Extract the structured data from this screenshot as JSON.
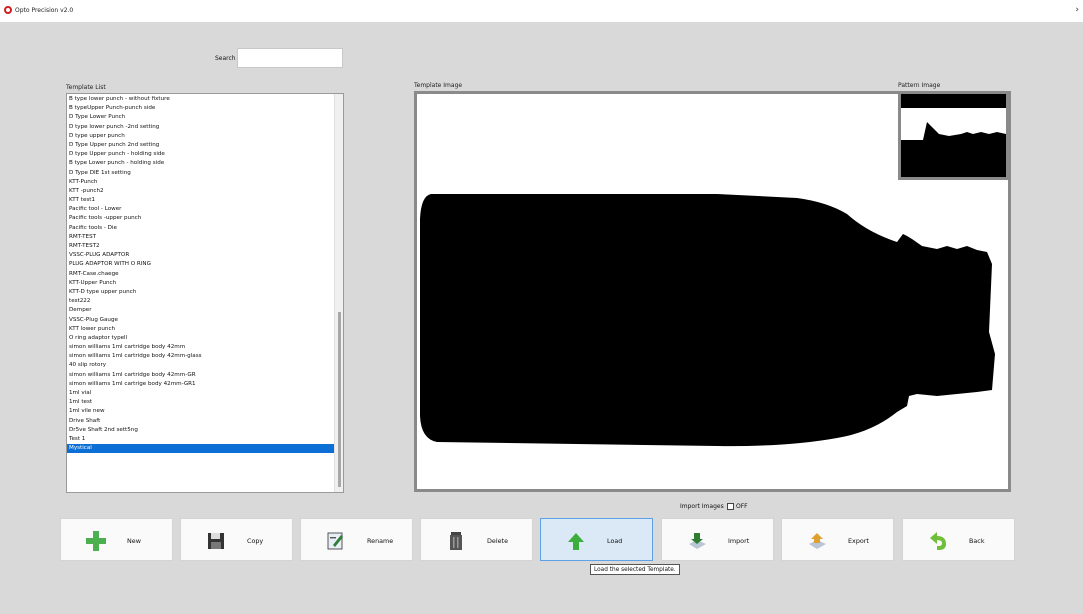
{
  "window": {
    "title": "Opto Precision v2.0"
  },
  "search": {
    "label": "Search",
    "value": ""
  },
  "template_list": {
    "label": "Template List",
    "items": [
      "B type lower punch - without fixture",
      "B typeUpper Punch-punch side",
      "D Type  Lower Punch",
      "D type lower punch -2nd setting",
      "D type upper punch",
      "D Type Upper punch 2nd setting",
      "D type Upper punch - holding side",
      "B type Lower punch - holding side",
      "D Type DIE 1st setting",
      "KTT-Punch",
      "KTT -punch2",
      "KTT test1",
      "Pacific tool - Lower",
      "Pacific tools -upper punch",
      "Pacific tools - Die",
      "RMT-TEST",
      "RMT-TEST2",
      "VSSC-PLUG ADAPTOR",
      "PLUG ADAPTOR WITH O RING",
      "RMT-Case.chaege",
      "KTT-Upper Punch",
      "KTT-D type upper punch",
      "test222",
      "Demper",
      "VSSC-Plug Gauge",
      "KTT lower punch",
      "O ring adaptor typell",
      "simon williams 1ml cartridge body 42mm",
      "simon williams 1ml cartridge body 42mm-glass",
      "40 slip rotory",
      "simon williams 1ml cartridge body 42mm-GR",
      "simon williams 1ml cartrige body 42mm-GR1",
      "1ml vial",
      "1ml test",
      "1ml vile new",
      "Drive Shaft",
      "Dr5ve Shaft 2nd sett5ng",
      "Test 1",
      "Mystical"
    ],
    "selected_index": 38
  },
  "template_image": {
    "label": "Template Image"
  },
  "pattern_image": {
    "label": "Pattern Image"
  },
  "import_images": {
    "label": "Import Images",
    "state": "OFF",
    "checked": false
  },
  "buttons": [
    {
      "name": "new",
      "label": "New",
      "icon": "plus-icon",
      "color": "#4caf50"
    },
    {
      "name": "copy",
      "label": "Copy",
      "icon": "floppy-disk-icon",
      "color": "#333333"
    },
    {
      "name": "rename",
      "label": "Rename",
      "icon": "rename-icon",
      "color": "#2e7d32"
    },
    {
      "name": "delete",
      "label": "Delete",
      "icon": "trash-icon",
      "color": "#444444"
    },
    {
      "name": "load",
      "label": "Load",
      "icon": "arrow-up-icon",
      "color": "#3cae3c"
    },
    {
      "name": "import",
      "label": "Import",
      "icon": "import-icon",
      "color": "#2e7d32"
    },
    {
      "name": "export",
      "label": "Export",
      "icon": "export-icon",
      "color": "#2e7d32"
    },
    {
      "name": "back",
      "label": "Back",
      "icon": "back-arrow-icon",
      "color": "#6fbf3a"
    }
  ],
  "tooltip": {
    "text": "Load the selected Template."
  },
  "colors": {
    "background": "#d9d9d9",
    "selection": "#0b6fd6",
    "active_button_border": "#5ea2e6"
  }
}
